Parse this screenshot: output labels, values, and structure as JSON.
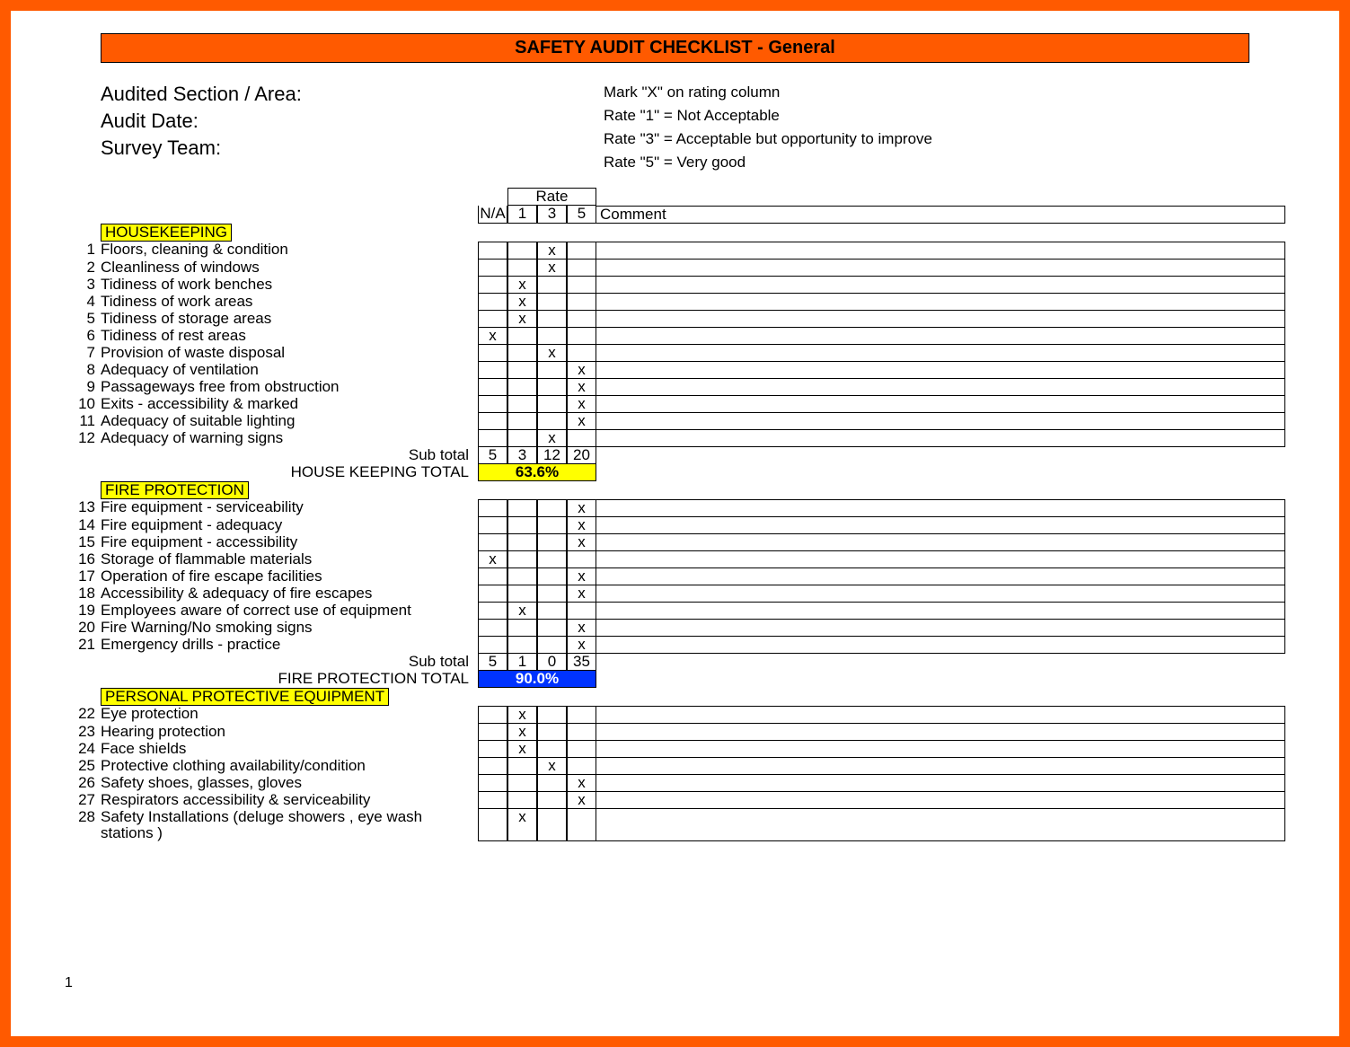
{
  "title": "SAFETY AUDIT CHECKLIST - General",
  "header": {
    "l1": "Audited Section / Area:",
    "l2": "Audit Date:",
    "l3": "Survey Team:",
    "r1": "Mark \"X\" on rating column",
    "r2": "Rate \"1\" = Not Acceptable",
    "r3": "Rate \"3\" = Acceptable but opportunity to improve",
    "r4": "Rate \"5\" = Very good"
  },
  "columns": {
    "rate": "Rate",
    "na": "N/A",
    "c1": "1",
    "c3": "3",
    "c5": "5",
    "comment": "Comment",
    "subtotal": "Sub total"
  },
  "sections": [
    {
      "name": "HOUSEKEEPING",
      "total_label": "HOUSE KEEPING TOTAL",
      "total_value": "63.6%",
      "total_style": "yellow",
      "subtotal": {
        "na": "5",
        "c1": "3",
        "c3": "12",
        "c5": "20"
      },
      "rows": [
        {
          "n": "1",
          "d": "Floors, cleaning & condition",
          "m": "c3"
        },
        {
          "n": "2",
          "d": "Cleanliness of windows",
          "m": "c3"
        },
        {
          "n": "3",
          "d": "Tidiness of work benches",
          "m": "c1"
        },
        {
          "n": "4",
          "d": "Tidiness of work areas",
          "m": "c1"
        },
        {
          "n": "5",
          "d": "Tidiness of storage areas",
          "m": "c1"
        },
        {
          "n": "6",
          "d": "Tidiness of rest areas",
          "m": "na"
        },
        {
          "n": "7",
          "d": "Provision of waste disposal",
          "m": "c3"
        },
        {
          "n": "8",
          "d": "Adequacy of ventilation",
          "m": "c5"
        },
        {
          "n": "9",
          "d": "Passageways free from obstruction",
          "m": "c5"
        },
        {
          "n": "10",
          "d": "Exits - accessibility & marked",
          "m": "c5"
        },
        {
          "n": "11",
          "d": "Adequacy of suitable lighting",
          "m": "c5"
        },
        {
          "n": "12",
          "d": "Adequacy of warning signs",
          "m": "c3"
        }
      ]
    },
    {
      "name": "FIRE PROTECTION",
      "total_label": "FIRE PROTECTION TOTAL",
      "total_value": "90.0%",
      "total_style": "blue",
      "subtotal": {
        "na": "5",
        "c1": "1",
        "c3": "0",
        "c5": "35"
      },
      "rows": [
        {
          "n": "13",
          "d": "Fire equipment - serviceability",
          "m": "c5"
        },
        {
          "n": "14",
          "d": "Fire equipment - adequacy",
          "m": "c5"
        },
        {
          "n": "15",
          "d": "Fire equipment - accessibility",
          "m": "c5"
        },
        {
          "n": "16",
          "d": "Storage of flammable materials",
          "m": "na"
        },
        {
          "n": "17",
          "d": "Operation of fire escape facilities",
          "m": "c5"
        },
        {
          "n": "18",
          "d": "Accessibility & adequacy of fire escapes",
          "m": "c5"
        },
        {
          "n": "19",
          "d": "Employees aware of correct use of equipment",
          "m": "c1"
        },
        {
          "n": "20",
          "d": "Fire Warning/No smoking signs",
          "m": "c5"
        },
        {
          "n": "21",
          "d": "Emergency drills - practice",
          "m": "c5"
        }
      ]
    },
    {
      "name": "PERSONAL PROTECTIVE EQUIPMENT",
      "rows": [
        {
          "n": "22",
          "d": "Eye protection",
          "m": "c1"
        },
        {
          "n": "23",
          "d": "Hearing protection",
          "m": "c1"
        },
        {
          "n": "24",
          "d": "Face shields",
          "m": "c1"
        },
        {
          "n": "25",
          "d": "Protective clothing availability/condition",
          "m": "c3"
        },
        {
          "n": "26",
          "d": "Safety shoes, glasses, gloves",
          "m": "c5"
        },
        {
          "n": "27",
          "d": "Respirators accessibility & serviceability",
          "m": "c5"
        },
        {
          "n": "28",
          "d": "Safety Installations (deluge showers , eye wash stations )",
          "m": "c1"
        }
      ]
    }
  ],
  "page": "1"
}
